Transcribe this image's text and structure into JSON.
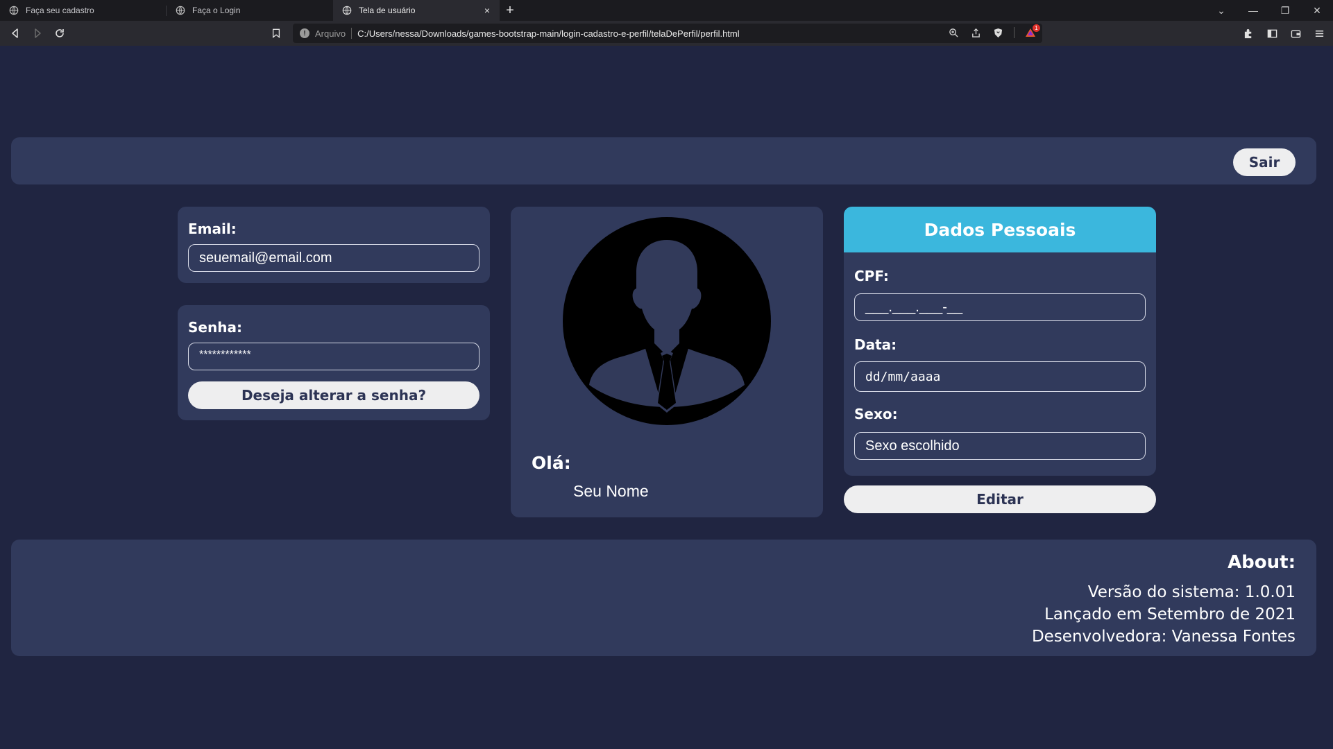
{
  "browser": {
    "tabs": [
      {
        "title": "Faça seu cadastro",
        "active": false,
        "icon": "globe-icon"
      },
      {
        "title": "Faça o Login",
        "active": false,
        "icon": "globe-icon"
      },
      {
        "title": "Tela de usuário",
        "active": true,
        "icon": "globe-icon"
      }
    ],
    "new_tab_glyph": "+",
    "close_glyph": "×",
    "window_controls": {
      "dropdown": "⌄",
      "minimize": "—",
      "restore": "❐",
      "close": "✕"
    },
    "address": {
      "scheme": "Arquivo",
      "url": "C:/Users/nessa/Downloads/games-bootstrap-main/login-cadastro-e-perfil/telaDePerfil/perfil.html"
    },
    "shield_badge": "1"
  },
  "header": {
    "logout_label": "Sair"
  },
  "account": {
    "email_label": "Email:",
    "email_value": "seuemail@email.com",
    "password_label": "Senha:",
    "password_value": "************",
    "change_password_label": "Deseja alterar a senha?"
  },
  "profile": {
    "greeting": "Olá:",
    "name": "Seu Nome"
  },
  "personal": {
    "title": "Dados Pessoais",
    "cpf_label": "CPF:",
    "cpf_value": "___.___.___-__",
    "date_label": "Data:",
    "date_value": "dd/mm/aaaa",
    "sex_label": "Sexo:",
    "sex_value": "Sexo escolhido",
    "edit_label": "Editar"
  },
  "about": {
    "title": "About:",
    "version": "Versão do sistema: 1.0.01",
    "release": "Lançado em Setembro de 2021",
    "developer": "Desenvolvedora: Vanessa Fontes"
  },
  "colors": {
    "page_bg": "#202541",
    "card_bg": "#313a5c",
    "accent": "#3bb7dd",
    "button_bg": "#eeeeef",
    "button_text": "#2c3354"
  }
}
